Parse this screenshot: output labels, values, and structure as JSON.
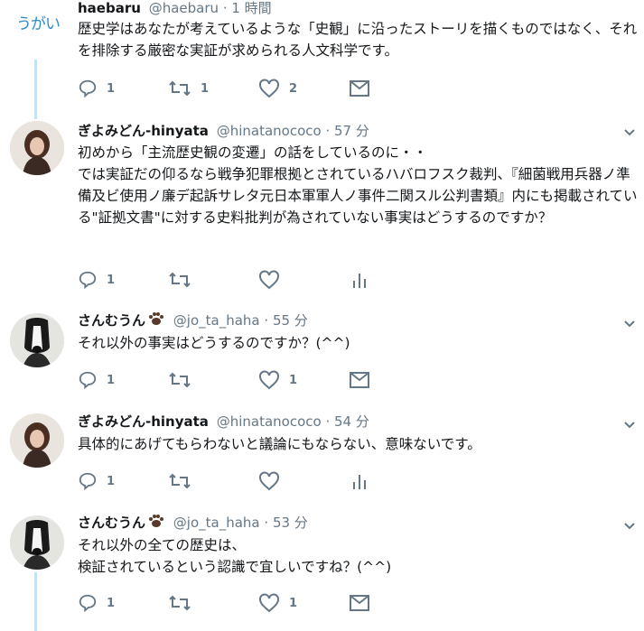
{
  "tweets": [
    {
      "avatar_text": "うがい",
      "name": "haebaru",
      "handle": "@haebaru",
      "time": "· 1 時間",
      "body": "歴史学はあなたが考えているような「史観」に沿ったストーリを描くものではなく、それを排除する厳密な実証が求められる人文科学です。",
      "actions": {
        "reply": "1",
        "retweet": "1",
        "like": "2"
      },
      "last_icon": "mail-icon"
    },
    {
      "name": "ぎよみどん-hinyata",
      "handle": "@hinatanococo",
      "time": "· 57 分",
      "body": "初めから「主流歴史観の変遷」の話をしているのに・・\nでは実証だの仰るなら戦争犯罪根拠とされているハバロフスク裁判、『細菌戦用兵器ノ準備及ビ使用ノ廉デ起訴サレタ元日本軍軍人ノ事件二関スル公判書類』内にも掲載されている\"証拠文書\"に対する史料批判が為されていない事実はどうするのですか？",
      "actions": {
        "reply": "1",
        "retweet": "",
        "like": ""
      },
      "last_icon": "analytics-icon"
    },
    {
      "name": "さんむうん",
      "handle": "@jo_ta_haha",
      "time": "· 55 分",
      "body": "それ以外の事実はどうするのですか？(^^)",
      "actions": {
        "reply": "1",
        "retweet": "",
        "like": "1"
      },
      "last_icon": "mail-icon"
    },
    {
      "name": "ぎよみどん-hinyata",
      "handle": "@hinatanococo",
      "time": "· 54 分",
      "body": "具体的にあげてもらわないと議論にもならない、意味ないです。",
      "actions": {
        "reply": "1",
        "retweet": "",
        "like": ""
      },
      "last_icon": "analytics-icon"
    },
    {
      "name": "さんむうん",
      "handle": "@jo_ta_haha",
      "time": "· 53 分",
      "body": "それ以外の全ての歴史は、\n検証されているという認識で宜しいですね？(^^)",
      "actions": {
        "reply": "1",
        "retweet": "",
        "like": "1"
      },
      "last_icon": "mail-icon"
    }
  ],
  "colors": {
    "thread_line": "#c5e1f5",
    "icon": "#657786",
    "text": "#14171a"
  }
}
